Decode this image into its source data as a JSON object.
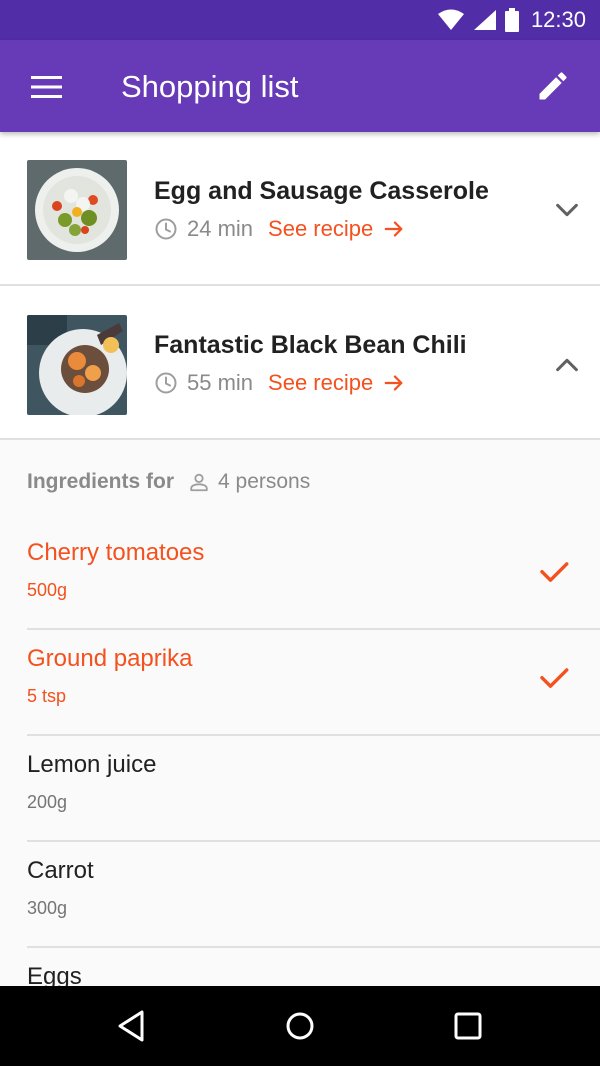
{
  "status_bar": {
    "time": "12:30"
  },
  "app_bar": {
    "title": "Shopping list"
  },
  "recipes": [
    {
      "title": "Egg and Sausage Casserole",
      "time": "24 min",
      "link": "See recipe",
      "expanded": false
    },
    {
      "title": "Fantastic Black Bean Chili",
      "time": "55 min",
      "link": "See recipe",
      "expanded": true
    }
  ],
  "ingredients": {
    "label": "Ingredients for",
    "persons": "4 persons",
    "items": [
      {
        "name": "Cherry tomatoes",
        "qty": "500g",
        "checked": true
      },
      {
        "name": "Ground paprika",
        "qty": "5 tsp",
        "checked": true
      },
      {
        "name": "Lemon juice",
        "qty": "200g",
        "checked": false
      },
      {
        "name": "Carrot",
        "qty": "300g",
        "checked": false
      },
      {
        "name": "Eggs",
        "qty": "",
        "checked": false
      }
    ]
  },
  "colors": {
    "primary": "#673ab7",
    "primary_dark": "#512da8",
    "accent": "#f4511e"
  },
  "icons": [
    "wifi-icon",
    "signal-icon",
    "battery-icon",
    "menu-icon",
    "edit-icon",
    "clock-icon",
    "arrow-right-icon",
    "chevron-down-icon",
    "chevron-up-icon",
    "person-icon",
    "check-icon",
    "back-icon",
    "home-icon",
    "recents-icon"
  ]
}
